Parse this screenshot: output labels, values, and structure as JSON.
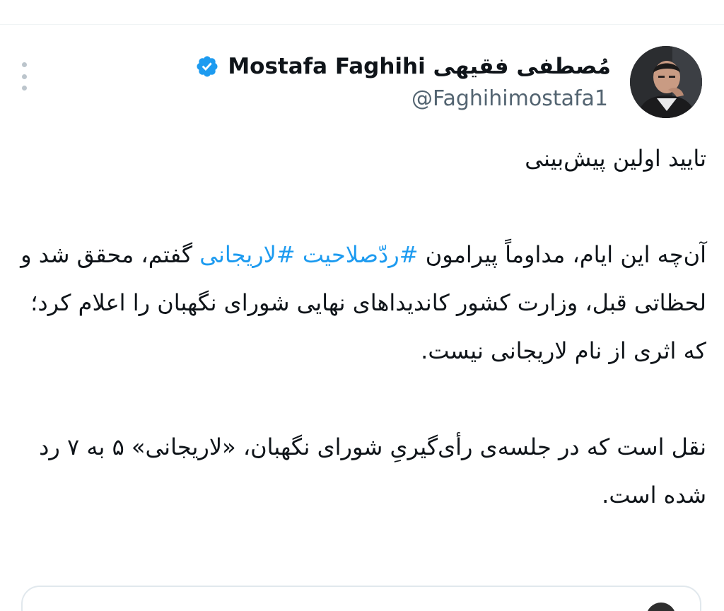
{
  "tweet": {
    "author": {
      "display_name": "Mostafa Faghihi مُصطفی فقیهی",
      "handle": "@Faghihimostafa1",
      "verified": true,
      "avatar_icon": "profile-photo"
    },
    "paragraphs": [
      {
        "segments": [
          {
            "text": "تایید اولین پیش‌بینی",
            "type": "text"
          }
        ]
      },
      {
        "segments": [
          {
            "text": "آن‌چه این ایام، مداوماً پیرامون ",
            "type": "text"
          },
          {
            "text": "#ردّصلاحیت",
            "type": "hashtag"
          },
          {
            "text": " ",
            "type": "text"
          },
          {
            "text": "#لاریجانی",
            "type": "hashtag"
          },
          {
            "text": " گفتم، محقق شد و لحظاتی قبل، وزارت کشور کاندیداهای نهایی شورای نگهبان را اعلام کرد؛ که اثری از نام لاریجانی نیست.",
            "type": "text"
          }
        ]
      },
      {
        "segments": [
          {
            "text": "نقل است که در جلسه‌ی رأی‌گیریِ شورای نگهبان، «لاریجانی» ۵ به ۷ رد شده است.",
            "type": "text"
          }
        ]
      }
    ]
  },
  "colors": {
    "hashtag": "#1d9bf0",
    "text": "#0f1419",
    "handle": "#536471",
    "verified_badge": "#1d9bf0"
  }
}
